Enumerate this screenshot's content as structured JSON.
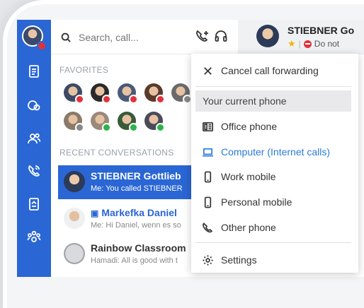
{
  "search": {
    "placeholder": "Search, call..."
  },
  "contact_header": {
    "name": "STIEBNER Go",
    "status": "Do not"
  },
  "favorites": {
    "title": "FAVORITES",
    "avatars": [
      {
        "status_color": "#e0323c"
      },
      {
        "status_color": "#e0323c"
      },
      {
        "status_color": "#e0323c"
      },
      {
        "status_color": "#e0323c"
      },
      {
        "status_color": "#888888"
      },
      {
        "status_color": "#888888"
      },
      {
        "status_color": "#2db24a"
      },
      {
        "status_color": "#2db24a"
      },
      {
        "status_color": "#2db24a"
      }
    ]
  },
  "recent": {
    "title": "RECENT CONVERSATIONS",
    "items": [
      {
        "name": "STIEBNER Gottlieb",
        "message": "Me: You called STIEBNER"
      },
      {
        "name": "Markefka Daniel",
        "message": "Me: Hi Daniel, wenn es so"
      },
      {
        "name": "Rainbow Classroom",
        "message": "Hamadi: All is good with t"
      }
    ]
  },
  "menu": {
    "cancel": "Cancel call forwarding",
    "current": "Your current phone",
    "office": "Office phone",
    "computer": "Computer (Internet calls)",
    "work_mobile": "Work mobile",
    "personal_mobile": "Personal mobile",
    "other": "Other phone",
    "settings": "Settings"
  },
  "colors": {
    "accent": "#2a66d4",
    "selected": "#2a7bd8",
    "busy": "#e0323c",
    "available": "#2db24a"
  },
  "icons": {
    "nav": [
      "notes-icon",
      "bubbles-icon",
      "contacts-icon",
      "phone-icon",
      "files-icon",
      "network-icon"
    ]
  }
}
